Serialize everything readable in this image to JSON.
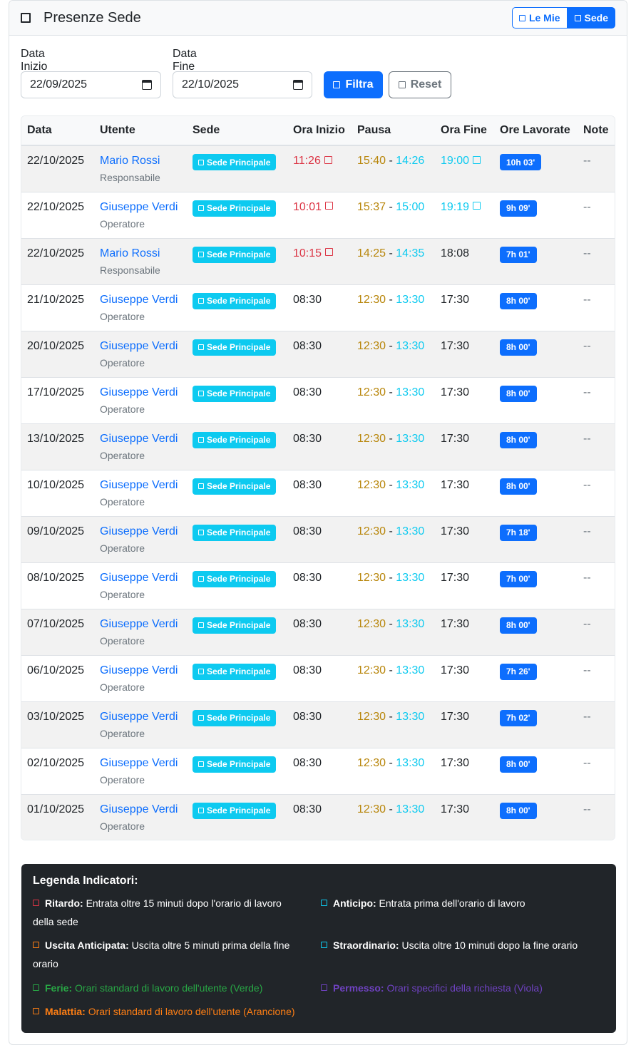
{
  "header": {
    "title": "Presenze Sede",
    "toggle_mine": "Le Mie",
    "toggle_sede": "Sede"
  },
  "filters": {
    "start_label": "Data Inizio",
    "start_value": "22/09/2025",
    "end_label": "Data Fine",
    "end_value": "22/10/2025",
    "filter_button": "Filtra",
    "reset_button": "Reset"
  },
  "table": {
    "columns": [
      "Data",
      "Utente",
      "Sede",
      "Ora Inizio",
      "Pausa",
      "Ora Fine",
      "Ore Lavorate",
      "Note"
    ],
    "rows": [
      {
        "date": "22/10/2025",
        "user": "Mario Rossi",
        "role": "Responsabile",
        "sede": "Sede Principale",
        "start": "11:26",
        "start_flag": "late",
        "pause_start": "15:40",
        "pause_end": "14:26",
        "end": "19:00",
        "end_flag": "overtime",
        "hours": "10h 03'",
        "note": "--"
      },
      {
        "date": "22/10/2025",
        "user": "Giuseppe Verdi",
        "role": "Operatore",
        "sede": "Sede Principale",
        "start": "10:01",
        "start_flag": "late",
        "pause_start": "15:37",
        "pause_end": "15:00",
        "end": "19:19",
        "end_flag": "overtime",
        "hours": "9h 09'",
        "note": "--"
      },
      {
        "date": "22/10/2025",
        "user": "Mario Rossi",
        "role": "Responsabile",
        "sede": "Sede Principale",
        "start": "10:15",
        "start_flag": "late",
        "pause_start": "14:25",
        "pause_end": "14:35",
        "end": "18:08",
        "end_flag": "",
        "hours": "7h 01'",
        "note": "--"
      },
      {
        "date": "21/10/2025",
        "user": "Giuseppe Verdi",
        "role": "Operatore",
        "sede": "Sede Principale",
        "start": "08:30",
        "start_flag": "",
        "pause_start": "12:30",
        "pause_end": "13:30",
        "end": "17:30",
        "end_flag": "",
        "hours": "8h 00'",
        "note": "--"
      },
      {
        "date": "20/10/2025",
        "user": "Giuseppe Verdi",
        "role": "Operatore",
        "sede": "Sede Principale",
        "start": "08:30",
        "start_flag": "",
        "pause_start": "12:30",
        "pause_end": "13:30",
        "end": "17:30",
        "end_flag": "",
        "hours": "8h 00'",
        "note": "--"
      },
      {
        "date": "17/10/2025",
        "user": "Giuseppe Verdi",
        "role": "Operatore",
        "sede": "Sede Principale",
        "start": "08:30",
        "start_flag": "",
        "pause_start": "12:30",
        "pause_end": "13:30",
        "end": "17:30",
        "end_flag": "",
        "hours": "8h 00'",
        "note": "--"
      },
      {
        "date": "13/10/2025",
        "user": "Giuseppe Verdi",
        "role": "Operatore",
        "sede": "Sede Principale",
        "start": "08:30",
        "start_flag": "",
        "pause_start": "12:30",
        "pause_end": "13:30",
        "end": "17:30",
        "end_flag": "",
        "hours": "8h 00'",
        "note": "--"
      },
      {
        "date": "10/10/2025",
        "user": "Giuseppe Verdi",
        "role": "Operatore",
        "sede": "Sede Principale",
        "start": "08:30",
        "start_flag": "",
        "pause_start": "12:30",
        "pause_end": "13:30",
        "end": "17:30",
        "end_flag": "",
        "hours": "8h 00'",
        "note": "--"
      },
      {
        "date": "09/10/2025",
        "user": "Giuseppe Verdi",
        "role": "Operatore",
        "sede": "Sede Principale",
        "start": "08:30",
        "start_flag": "",
        "pause_start": "12:30",
        "pause_end": "13:30",
        "end": "17:30",
        "end_flag": "",
        "hours": "7h 18'",
        "note": "--"
      },
      {
        "date": "08/10/2025",
        "user": "Giuseppe Verdi",
        "role": "Operatore",
        "sede": "Sede Principale",
        "start": "08:30",
        "start_flag": "",
        "pause_start": "12:30",
        "pause_end": "13:30",
        "end": "17:30",
        "end_flag": "",
        "hours": "7h 00'",
        "note": "--"
      },
      {
        "date": "07/10/2025",
        "user": "Giuseppe Verdi",
        "role": "Operatore",
        "sede": "Sede Principale",
        "start": "08:30",
        "start_flag": "",
        "pause_start": "12:30",
        "pause_end": "13:30",
        "end": "17:30",
        "end_flag": "",
        "hours": "8h 00'",
        "note": "--"
      },
      {
        "date": "06/10/2025",
        "user": "Giuseppe Verdi",
        "role": "Operatore",
        "sede": "Sede Principale",
        "start": "08:30",
        "start_flag": "",
        "pause_start": "12:30",
        "pause_end": "13:30",
        "end": "17:30",
        "end_flag": "",
        "hours": "7h 26'",
        "note": "--"
      },
      {
        "date": "03/10/2025",
        "user": "Giuseppe Verdi",
        "role": "Operatore",
        "sede": "Sede Principale",
        "start": "08:30",
        "start_flag": "",
        "pause_start": "12:30",
        "pause_end": "13:30",
        "end": "17:30",
        "end_flag": "",
        "hours": "7h 02'",
        "note": "--"
      },
      {
        "date": "02/10/2025",
        "user": "Giuseppe Verdi",
        "role": "Operatore",
        "sede": "Sede Principale",
        "start": "08:30",
        "start_flag": "",
        "pause_start": "12:30",
        "pause_end": "13:30",
        "end": "17:30",
        "end_flag": "",
        "hours": "8h 00'",
        "note": "--"
      },
      {
        "date": "01/10/2025",
        "user": "Giuseppe Verdi",
        "role": "Operatore",
        "sede": "Sede Principale",
        "start": "08:30",
        "start_flag": "",
        "pause_start": "12:30",
        "pause_end": "13:30",
        "end": "17:30",
        "end_flag": "",
        "hours": "8h 00'",
        "note": "--"
      }
    ]
  },
  "legend": {
    "title": "Legenda Indicatori:",
    "ritardo_label": "Ritardo:",
    "ritardo_text": "Entrata oltre 15 minuti dopo l'orario di lavoro",
    "ritardo_text2": "della sede",
    "anticipo_label": "Anticipo:",
    "anticipo_text": "Entrata prima dell'orario di lavoro",
    "uscita_label": "Uscita Anticipata:",
    "uscita_text": "Uscita oltre 5 minuti prima della fine",
    "uscita_text2": "orario",
    "straordinario_label": "Straordinario:",
    "straordinario_text": "Uscita oltre 10 minuti dopo la fine orario",
    "ferie_label": "Ferie:",
    "ferie_text": "Orari standard di lavoro dell'utente (Verde)",
    "permesso_label": "Permesso:",
    "permesso_text": "Orari specifici della richiesta (Viola)",
    "malattia_label": "Malattia:",
    "malattia_text": "Orari standard di lavoro dell'utente (Arancione)"
  },
  "colors": {
    "primary": "#0d6efd",
    "info": "#0dcaf0",
    "danger": "#dc3545",
    "warning": "#b8860b",
    "success": "#28a745",
    "purple": "#6f42c1",
    "orange": "#fd7e14",
    "dark": "#212529"
  }
}
